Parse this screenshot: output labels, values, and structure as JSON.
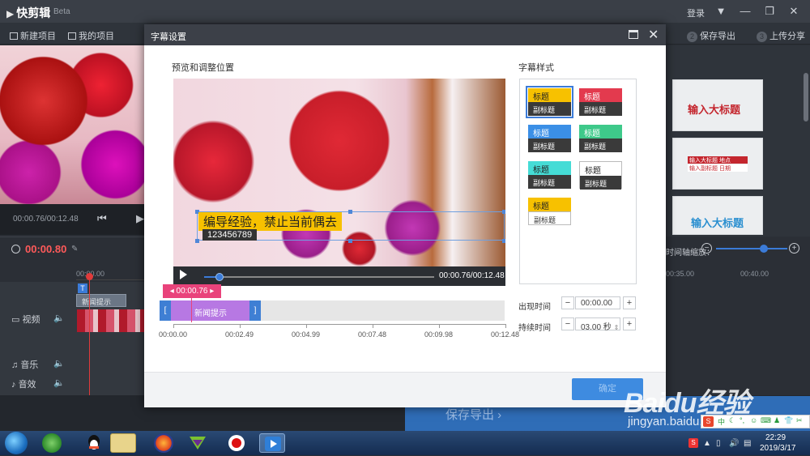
{
  "app": {
    "name": "快剪辑",
    "badge": "Beta",
    "login": "登录"
  },
  "toolbar": {
    "new_project": "新建项目",
    "my_projects": "我的项目",
    "steps": [
      {
        "num": "2",
        "label": "保存导出"
      },
      {
        "num": "3",
        "label": "上传分享"
      }
    ]
  },
  "left": {
    "preview_time": "00:00.76/00:12.48",
    "current_time": "00:00.80",
    "ruler_start": "00:00.00",
    "tracks": [
      {
        "label": "视频",
        "icon": "video-icon"
      },
      {
        "label": "音乐",
        "icon": "music-icon"
      },
      {
        "label": "音效",
        "icon": "sound-effect-icon"
      }
    ],
    "text_clip": "新闻提示",
    "text_chip": "T"
  },
  "right": {
    "templates": [
      "输入大标题",
      "输入大标题",
      "输入大标题"
    ],
    "template_small": [
      "输入大标题",
      "地点",
      "输入副标题",
      "日期"
    ],
    "zoom_label": "时间轴缩放：",
    "ruler": [
      "00:35.00",
      "00:40.00"
    ]
  },
  "bottom": {
    "save_export": "保存导出"
  },
  "dialog": {
    "title": "字幕设置",
    "preview_heading": "预览和调整位置",
    "style_heading": "字幕样式",
    "subtitle_main": "编导经验，禁止当前偶去",
    "subtitle_sub": "123456789",
    "video_time": "00:00.76/00:12.48",
    "cursor_time": "00:00.76",
    "clip_label": "新闻提示",
    "timeline_labels": [
      "00:00.00",
      "00:02.49",
      "00:04.99",
      "00:07.48",
      "00:09.98",
      "00:12.48"
    ],
    "styles": [
      {
        "title": "标题",
        "subtitle": "副标题",
        "top_bg": "#f7c100",
        "top_fg": "#222222",
        "selected": true
      },
      {
        "title": "标题",
        "subtitle": "副标题",
        "top_bg": "#e33a4e",
        "top_fg": "#ffffff",
        "selected": false
      },
      {
        "title": "标题",
        "subtitle": "副标题",
        "top_bg": "#3b8fe6",
        "top_fg": "#ffffff",
        "selected": false
      },
      {
        "title": "标题",
        "subtitle": "副标题",
        "top_bg": "#3ec98a",
        "top_fg": "#ffffff",
        "selected": false
      },
      {
        "title": "标题",
        "subtitle": "副标题",
        "top_bg": "#45dcd6",
        "top_fg": "#222222",
        "selected": false
      },
      {
        "title": "标题",
        "subtitle": "副标题",
        "top_bg": "#ffffff",
        "top_fg": "#222222",
        "selected": false
      },
      {
        "title": "标题",
        "subtitle": "副标题",
        "top_bg": "#f7c100",
        "top_fg": "#222222",
        "selected": false,
        "bottom_light": true
      }
    ],
    "appear_label": "出现时间",
    "appear_value": "00:00.00",
    "duration_label": "持续时间",
    "duration_value": "03.00 秒",
    "confirm": "确定"
  },
  "taskbar": {
    "time": "22:29",
    "date": "2019/3/17"
  },
  "watermark": {
    "brand": "Baidu经验",
    "url": "jingyan.baidu.com"
  },
  "colors": {
    "accent": "#3b7bd8",
    "timecode": "#ff5a5a",
    "cursor_pink": "#e9437b",
    "clip_purple": "#b778e3"
  }
}
